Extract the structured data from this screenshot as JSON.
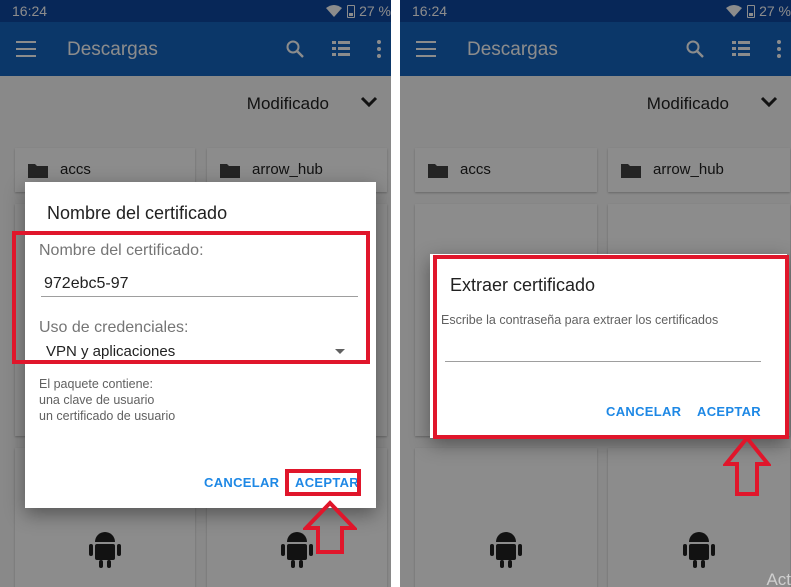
{
  "status": {
    "time": "16:24",
    "battery": "27 %"
  },
  "appbar": {
    "title": "Descargas",
    "icons": [
      "menu-icon",
      "search-icon",
      "list-view-icon",
      "more-vert-icon"
    ]
  },
  "sort": {
    "label": "Modificado"
  },
  "files": [
    {
      "name": "accs",
      "icon": "folder-icon"
    },
    {
      "name": "arrow_hub",
      "icon": "folder-icon"
    }
  ],
  "dialog_name": {
    "title": "Nombre del certificado",
    "field_label": "Nombre del certificado:",
    "field_value": "972ebc5-97",
    "usage_label": "Uso de credenciales:",
    "usage_value": "VPN y aplicaciones",
    "info": [
      "El paquete contiene:",
      "una clave de usuario",
      "un certificado de usuario"
    ],
    "cancel": "CANCELAR",
    "accept": "ACEPTAR"
  },
  "dialog_extract": {
    "title": "Extraer certificado",
    "message": "Escribe la contraseña para extraer los certificados",
    "password_value": "",
    "cancel": "CANCELAR",
    "accept": "ACEPTAR"
  },
  "watermark": "Act",
  "colors": {
    "statusbar": "#0d47a1",
    "appbar": "#1565c0",
    "accent": "#1e88e5",
    "highlight": "#e0162b"
  }
}
